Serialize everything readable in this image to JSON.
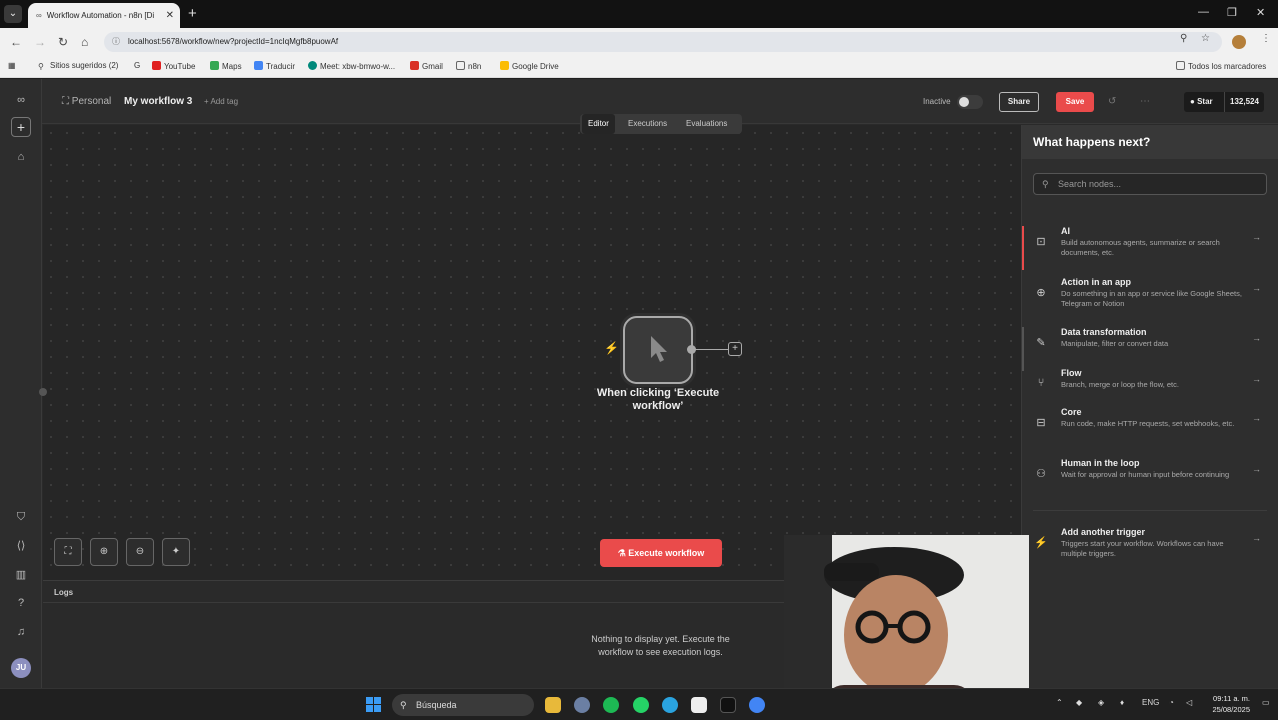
{
  "browser": {
    "tab_title": "Workflow Automation - n8n [Di",
    "url": "localhost:5678/workflow/new?projectId=1ncIqMgfb8puowAf",
    "bookmarks": [
      "Sitios sugeridos (2)",
      "YouTube",
      "Maps",
      "Traducir",
      "Meet: xbw-bmwo-w...",
      "Gmail",
      "n8n",
      "Google Drive"
    ],
    "bookmarks_right": "Todos los marcadores"
  },
  "header": {
    "project": "Personal",
    "workflow_name": "My workflow 3",
    "add_tag": "+ Add tag",
    "status": "Inactive",
    "share": "Share",
    "save": "Save",
    "github_star": "Star",
    "github_count": "132,524"
  },
  "canvas_tabs": [
    "Editor",
    "Executions",
    "Evaluations"
  ],
  "node": {
    "label": "When clicking ‘Execute workflow’"
  },
  "execute_button": "Execute workflow",
  "logs": {
    "title": "Logs",
    "empty": "Nothing to display yet. Execute the workflow to see execution logs."
  },
  "panel": {
    "title": "What happens next?",
    "search_placeholder": "Search nodes...",
    "items": [
      {
        "title": "AI",
        "desc": "Build autonomous agents, summarize or search documents, etc."
      },
      {
        "title": "Action in an app",
        "desc": "Do something in an app or service like Google Sheets, Telegram or Notion"
      },
      {
        "title": "Data transformation",
        "desc": "Manipulate, filter or convert data"
      },
      {
        "title": "Flow",
        "desc": "Branch, merge or loop the flow, etc."
      },
      {
        "title": "Core",
        "desc": "Run code, make HTTP requests, set webhooks, etc."
      },
      {
        "title": "Human in the loop",
        "desc": "Wait for approval or human input before continuing"
      },
      {
        "title": "Add another trigger",
        "desc": "Triggers start your workflow. Workflows can have multiple triggers."
      }
    ]
  },
  "taskbar": {
    "search": "Búsqueda",
    "lang": "ENG",
    "time": "09:11 a. m.",
    "date": "25/08/2025"
  },
  "colors": {
    "accent": "#ea4b4b",
    "canvas": "#262626",
    "panel": "#2e2e2e"
  }
}
